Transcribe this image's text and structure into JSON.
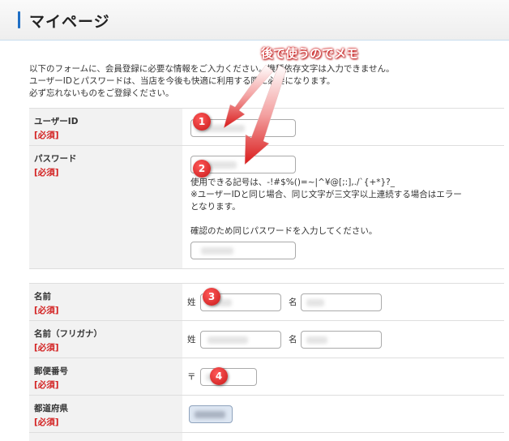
{
  "header": {
    "title": "マイページ"
  },
  "annotation": {
    "text": "後で使うのでメモ"
  },
  "intro": {
    "lines": [
      "以下のフォームに、会員登録に必要な情報をご入力ください。機種依存文字は入力できません。",
      "ユーザーIDとパスワードは、当店を今後も快適に利用する際に必要になります。",
      "必ず忘れないものをご登録ください。"
    ]
  },
  "fields": {
    "required": "[必須]",
    "user_id": {
      "label": "ユーザーID",
      "badge": "1"
    },
    "password": {
      "label": "パスワード",
      "badge": "2",
      "hint1": "使用できる記号は、-!#$%()=~|^¥@[;:],./`{+*}?_",
      "hint2": "※ユーザーIDと同じ場合、同じ文字が三文字以上連続する場合はエラー",
      "hint3": "となります。",
      "confirm": "確認のため同じパスワードを入力してください。"
    },
    "name": {
      "label": "名前",
      "sei": "姓",
      "mei": "名",
      "badge": "3"
    },
    "kana": {
      "label": "名前（フリガナ）",
      "sei": "姓",
      "mei": "名"
    },
    "postal": {
      "label": "郵便番号",
      "mark": "〒",
      "badge": "4"
    },
    "pref": {
      "label": "都道府県"
    }
  },
  "colors": {
    "accent": "#1f6fc5",
    "required": "#d32222",
    "badge": "#e02020"
  }
}
